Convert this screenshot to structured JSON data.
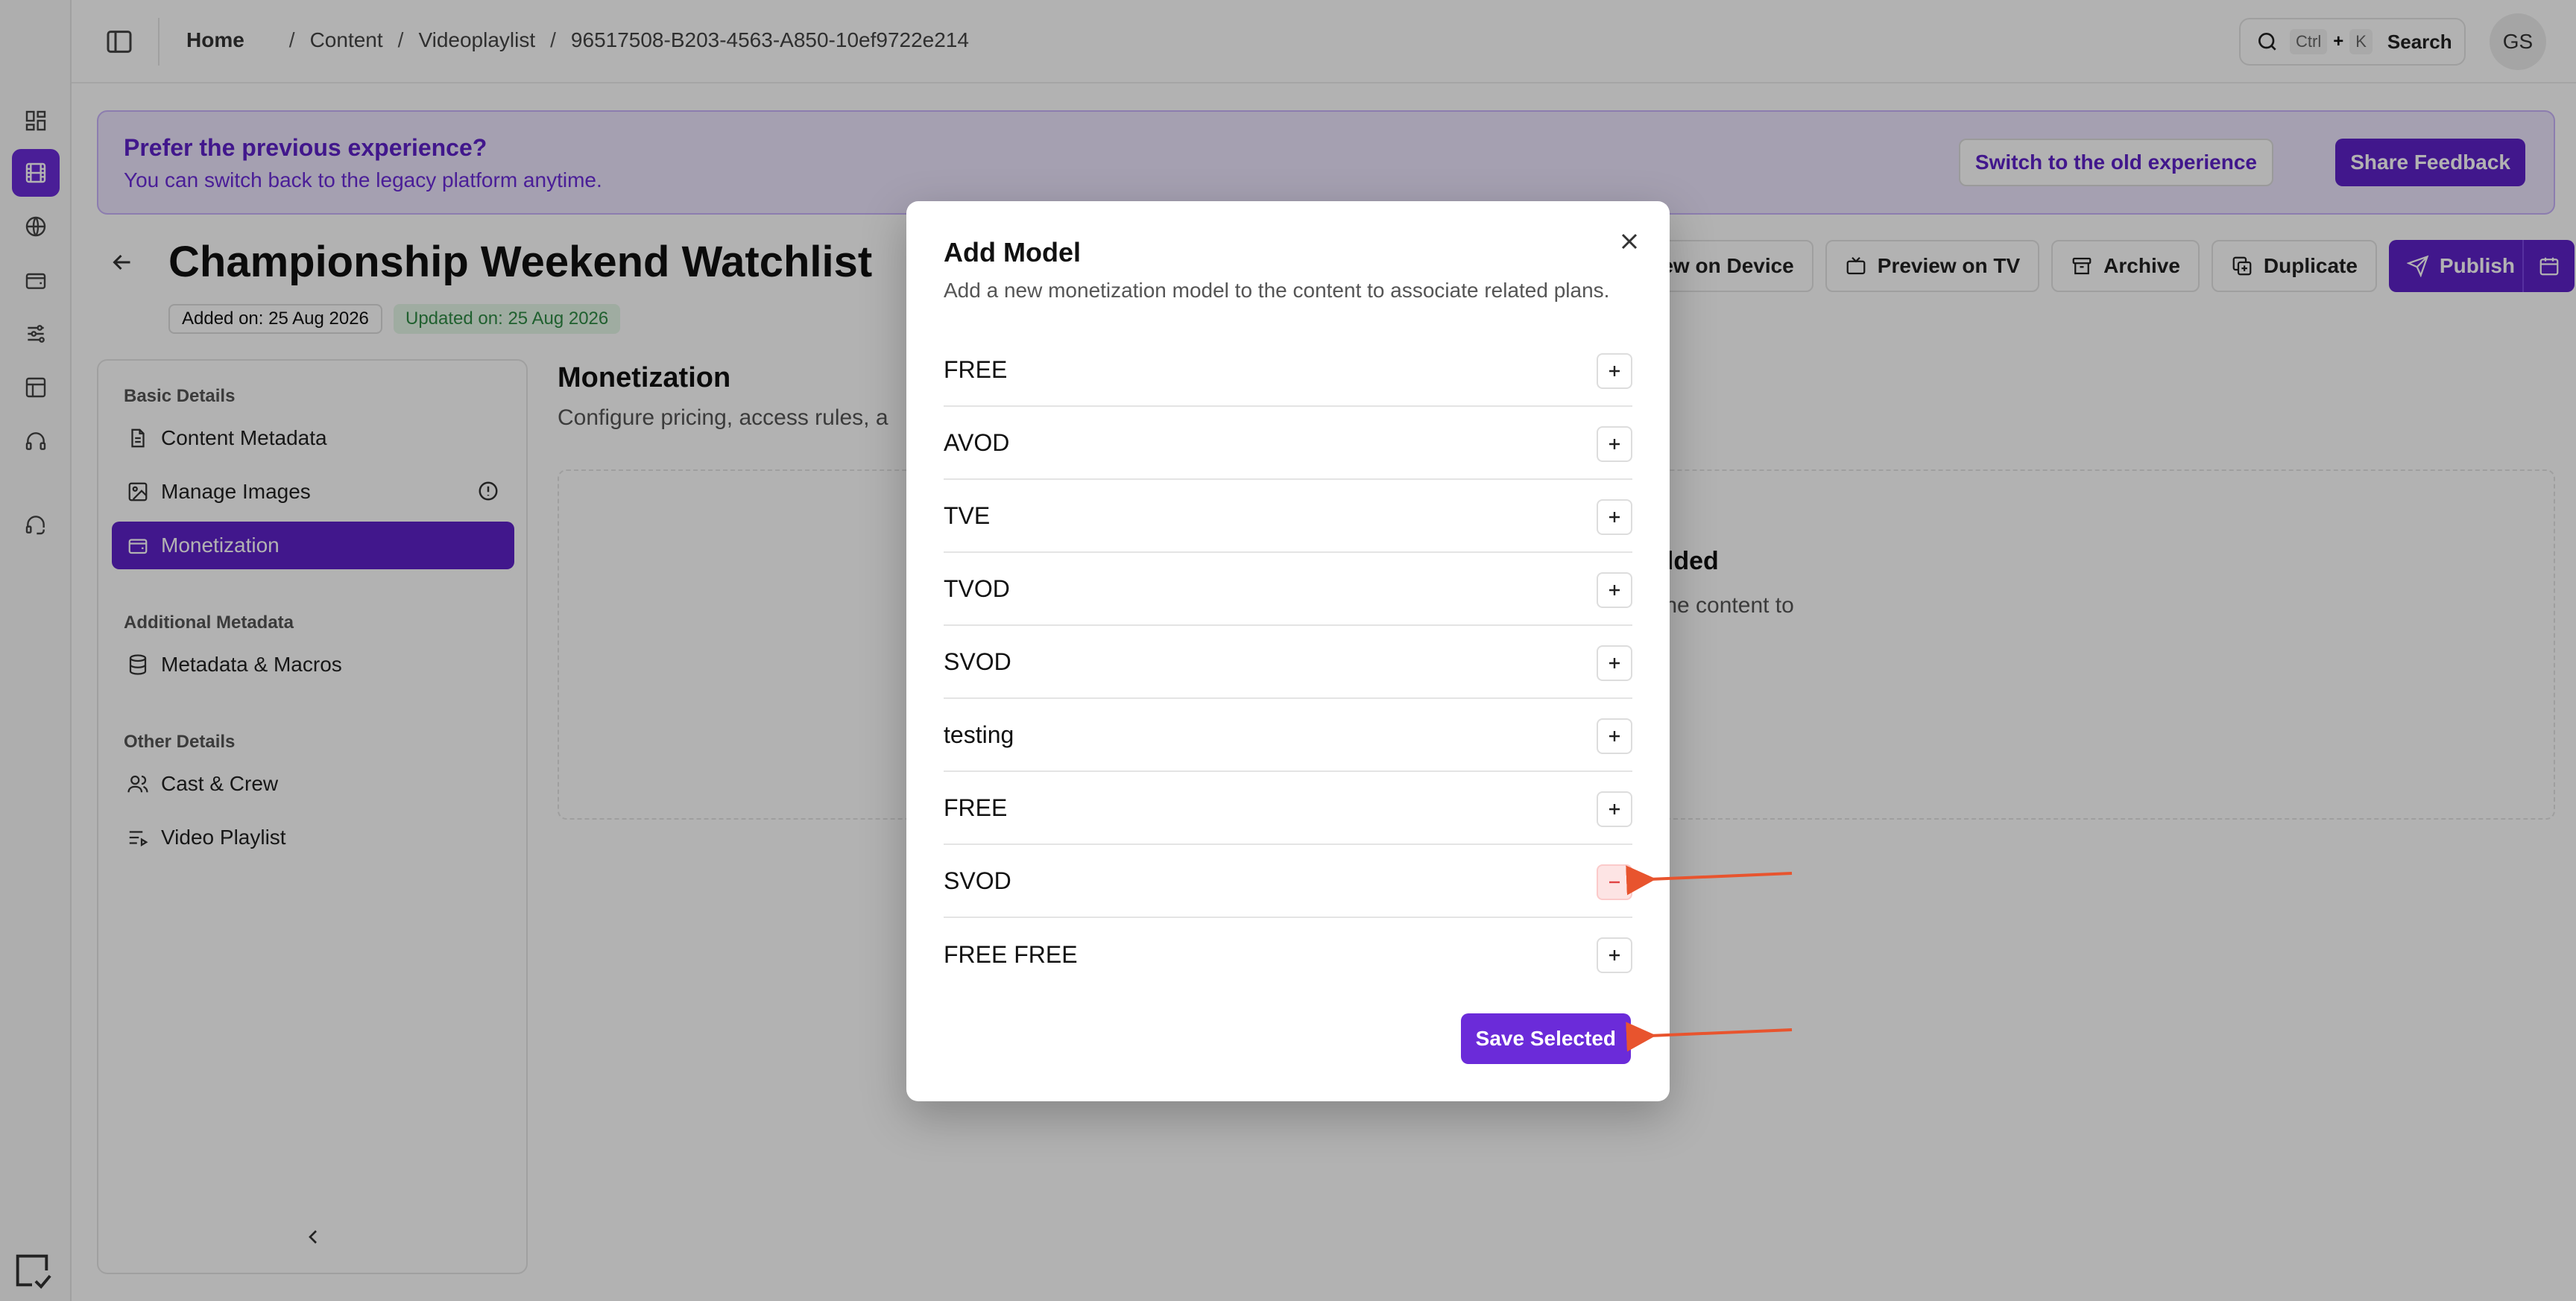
{
  "topbar": {
    "breadcrumb": [
      "Home",
      "Content",
      "Videoplaylist",
      "96517508-B203-4563-A850-10ef9722e214"
    ],
    "search": {
      "kbd_ctrl": "Ctrl",
      "kbd_plus": "+",
      "kbd_k": "K",
      "label": "Search"
    },
    "avatar_initials": "GS"
  },
  "banner": {
    "title": "Prefer the previous experience?",
    "subtitle": "You can switch back to the legacy platform anytime.",
    "switch_label": "Switch to the old experience",
    "feedback_label": "Share Feedback"
  },
  "header": {
    "title": "Championship Weekend Watchlist",
    "added": "Added on: 25 Aug 2026",
    "updated": "Updated on: 25 Aug 2026",
    "actions": {
      "preview_device": "view on Device",
      "preview_tv": "Preview on TV",
      "archive": "Archive",
      "duplicate": "Duplicate",
      "publish": "Publish"
    }
  },
  "leftnav": {
    "sections": [
      {
        "label": "Basic Details"
      },
      {
        "label": "Additional Metadata"
      },
      {
        "label": "Other Details"
      }
    ],
    "items": [
      {
        "label": "Content Metadata"
      },
      {
        "label": "Manage Images"
      },
      {
        "label": "Monetization"
      },
      {
        "label": "Metadata & Macros"
      },
      {
        "label": "Cast & Crew"
      },
      {
        "label": "Video Playlist"
      }
    ]
  },
  "main": {
    "title": "Monetization",
    "subtitle": "Configure pricing, access rules, a",
    "empty_title": "Added",
    "empty_sub_1": "o the content to",
    "empty_sub_2": "."
  },
  "modal": {
    "title": "Add Model",
    "subtitle": "Add a new monetization model to the content to associate related plans.",
    "models": [
      {
        "label": "FREE",
        "selected": false
      },
      {
        "label": "AVOD",
        "selected": false
      },
      {
        "label": "TVE",
        "selected": false
      },
      {
        "label": "TVOD",
        "selected": false
      },
      {
        "label": "SVOD",
        "selected": false
      },
      {
        "label": "testing",
        "selected": false
      },
      {
        "label": "FREE",
        "selected": false
      },
      {
        "label": "SVOD",
        "selected": true
      },
      {
        "label": "FREE FREE",
        "selected": false
      }
    ],
    "save_label": "Save Selected"
  },
  "colors": {
    "brand": "#5e22c9",
    "annotation": "#e8542e",
    "remove": "#e04545"
  }
}
